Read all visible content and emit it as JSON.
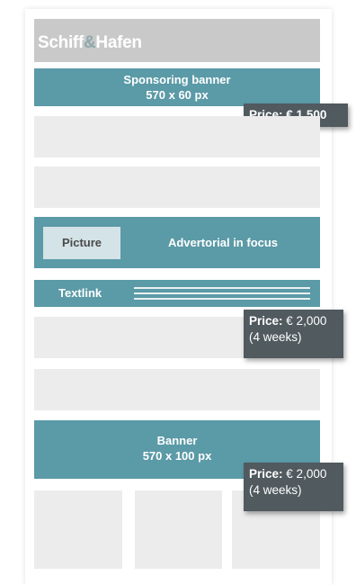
{
  "header": {
    "logo_part1": "Schiff",
    "logo_amp": "&",
    "logo_part2": "Hafen"
  },
  "sponsoring_banner": {
    "title": "Sponsoring banner",
    "size": "570 x 60 px"
  },
  "price1": {
    "label": "Price:",
    "value": "€ 1,500"
  },
  "advertorial": {
    "picture_label": "Picture",
    "title": "Advertorial in focus"
  },
  "textlink": {
    "label": "Textlink"
  },
  "price2": {
    "label": "Price:",
    "value": "€ 2,000",
    "duration": "(4 weeks)"
  },
  "banner": {
    "title": "Banner",
    "size": "570 x 100 px"
  },
  "price3": {
    "label": "Price:",
    "value": "€ 2,000",
    "duration": "(4 weeks)"
  },
  "colors": {
    "teal": "#5b9aa7",
    "gray_block": "#ececec",
    "header": "#c9c9c9",
    "price_box": "#505a5f"
  }
}
